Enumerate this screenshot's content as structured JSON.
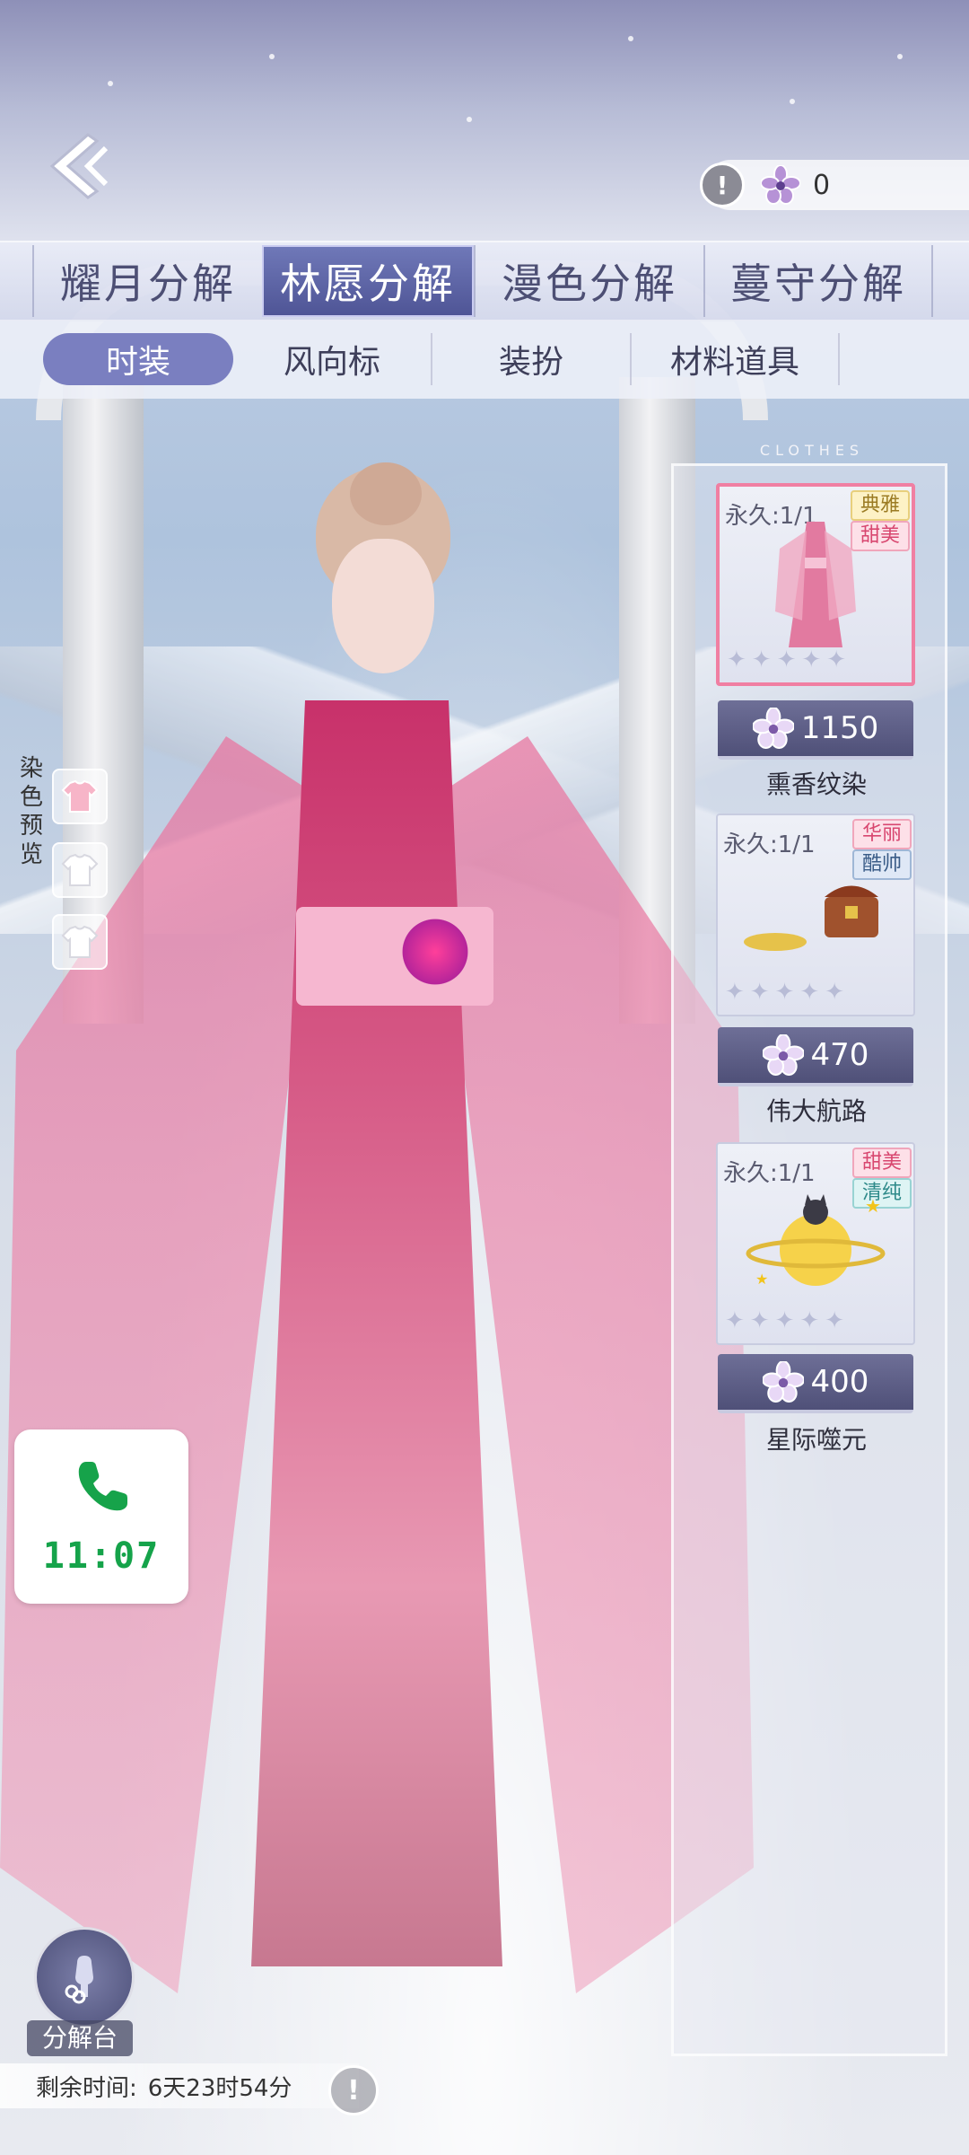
{
  "top": {
    "back_icon": "back-arrow-icon",
    "currency_info_icon": "!",
    "currency_icon": "petal-gem-icon",
    "currency_value": "0"
  },
  "tabs": [
    {
      "label": "耀月分解",
      "active": false
    },
    {
      "label": "林愿分解",
      "active": true
    },
    {
      "label": "漫色分解",
      "active": false
    },
    {
      "label": "蔓守分解",
      "active": false
    }
  ],
  "subtabs": [
    {
      "label": "时装",
      "active": true
    },
    {
      "label": "风向标",
      "active": false
    },
    {
      "label": "装扮",
      "active": false
    },
    {
      "label": "材料道具",
      "active": false
    }
  ],
  "dye_preview": {
    "label_chars": [
      "染",
      "色",
      "预",
      "览"
    ],
    "swatches": [
      "pink",
      "white",
      "white"
    ]
  },
  "panel": {
    "deco_text": "CLOTHES",
    "items": [
      {
        "perm": "永久:1/1",
        "tags": [
          "典雅",
          "甜美"
        ],
        "tag_colors": [
          "yellow",
          "pink"
        ],
        "price": "1150",
        "name": "熏香纹染",
        "selected": true
      },
      {
        "perm": "永久:1/1",
        "tags": [
          "华丽",
          "酷帅"
        ],
        "tag_colors": [
          "pink",
          "blue"
        ],
        "price": "470",
        "name": "伟大航路",
        "selected": false
      },
      {
        "perm": "永久:1/1",
        "tags": [
          "甜美",
          "清纯"
        ],
        "tag_colors": [
          "pink",
          "teal"
        ],
        "price": "400",
        "name": "星际噬元",
        "selected": false
      }
    ]
  },
  "phone_widget": {
    "icon": "phone-icon",
    "time": "11:07"
  },
  "bottom": {
    "decompose_label": "分解台",
    "time_label": "剩余时间:",
    "time_value": "6天23时54分",
    "info_icon": "!"
  }
}
